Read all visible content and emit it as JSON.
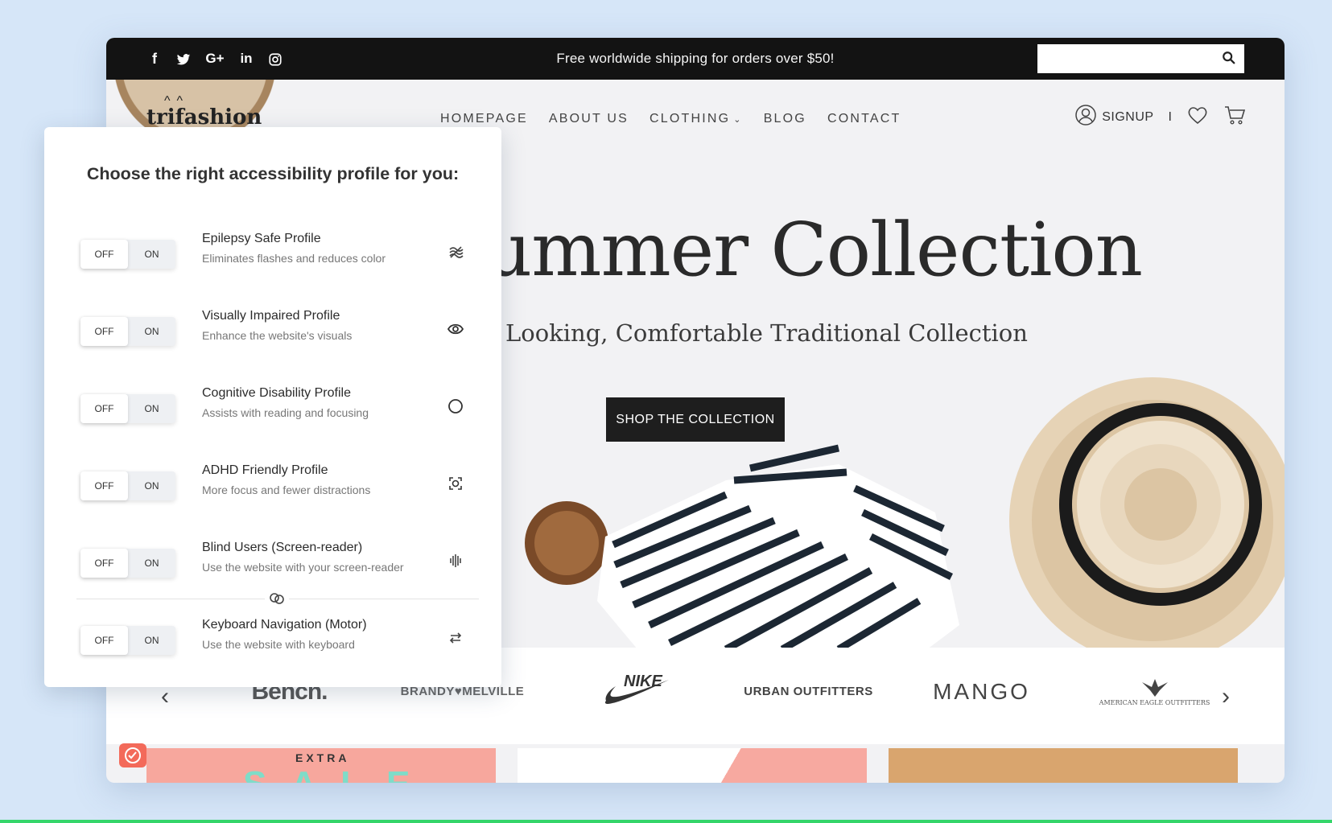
{
  "topbar": {
    "promo": "Free worldwide shipping for orders over $50!",
    "search_placeholder": "",
    "socials": [
      "facebook-icon",
      "twitter-icon",
      "google-plus-icon",
      "linkedin-icon",
      "instagram-icon"
    ]
  },
  "header": {
    "logo": "trifashion",
    "nav": [
      "HOMEPAGE",
      "ABOUT US",
      "CLOTHING",
      "BLOG",
      "CONTACT"
    ],
    "signup": "SIGNUP",
    "divider": "I"
  },
  "hero": {
    "title": "ummer Collection",
    "subtitle": "Looking, Comfortable Traditional Collection",
    "button": "SHOP THE COLLECTION"
  },
  "brands": [
    "Bench.",
    "BRANDY♥MELVILLE",
    "NIKE",
    "URBAN OUTFITTERS",
    "MANGO",
    "AMERICAN EAGLE OUTFITTERS"
  ],
  "promo_tiles": {
    "extra": "EXTRA",
    "sale": "SALE"
  },
  "panel": {
    "title": "Choose the right accessibility profile for you:",
    "off_label": "OFF",
    "on_label": "ON",
    "profiles": [
      {
        "name": "Epilepsy Safe Profile",
        "desc": "Eliminates flashes and reduces color",
        "icon": "wave-icon",
        "state": "OFF"
      },
      {
        "name": "Visually Impaired Profile",
        "desc": "Enhance the website's visuals",
        "icon": "eye-icon",
        "state": "OFF"
      },
      {
        "name": "Cognitive Disability Profile",
        "desc": "Assists with reading and focusing",
        "icon": "circle-icon",
        "state": "OFF"
      },
      {
        "name": "ADHD Friendly Profile",
        "desc": "More focus and fewer distractions",
        "icon": "focus-icon",
        "state": "OFF"
      },
      {
        "name": "Blind Users (Screen-reader)",
        "desc": "Use the website with your screen-reader",
        "icon": "sound-bars-icon",
        "state": "OFF"
      },
      {
        "name": "Keyboard Navigation (Motor)",
        "desc": "Use the website with keyboard",
        "icon": "swap-arrows-icon",
        "state": "OFF"
      }
    ]
  },
  "colors": {
    "background": "#d6e6f8",
    "topbar": "#131313",
    "button": "#1e1e1e",
    "badge": "#f36a5a"
  }
}
